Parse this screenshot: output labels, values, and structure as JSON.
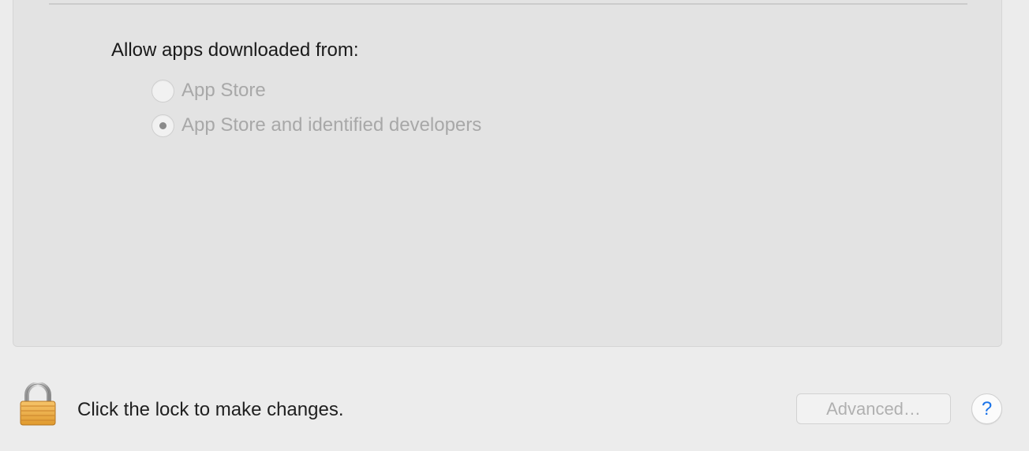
{
  "gatekeeper": {
    "heading": "Allow apps downloaded from:",
    "options": [
      {
        "label": "App Store",
        "selected": false,
        "enabled": false
      },
      {
        "label": "App Store and identified developers",
        "selected": true,
        "enabled": false
      }
    ]
  },
  "footer": {
    "lock_icon": "lock-icon",
    "lock_message": "Click the lock to make changes.",
    "advanced_label": "Advanced…",
    "advanced_enabled": false,
    "help_label": "?"
  },
  "colors": {
    "window_background": "#ececec",
    "panel_background": "#e3e3e3",
    "disabled_text": "#a8a8a8",
    "help_accent": "#1a73e8",
    "lock_gold": "#f3b247"
  }
}
